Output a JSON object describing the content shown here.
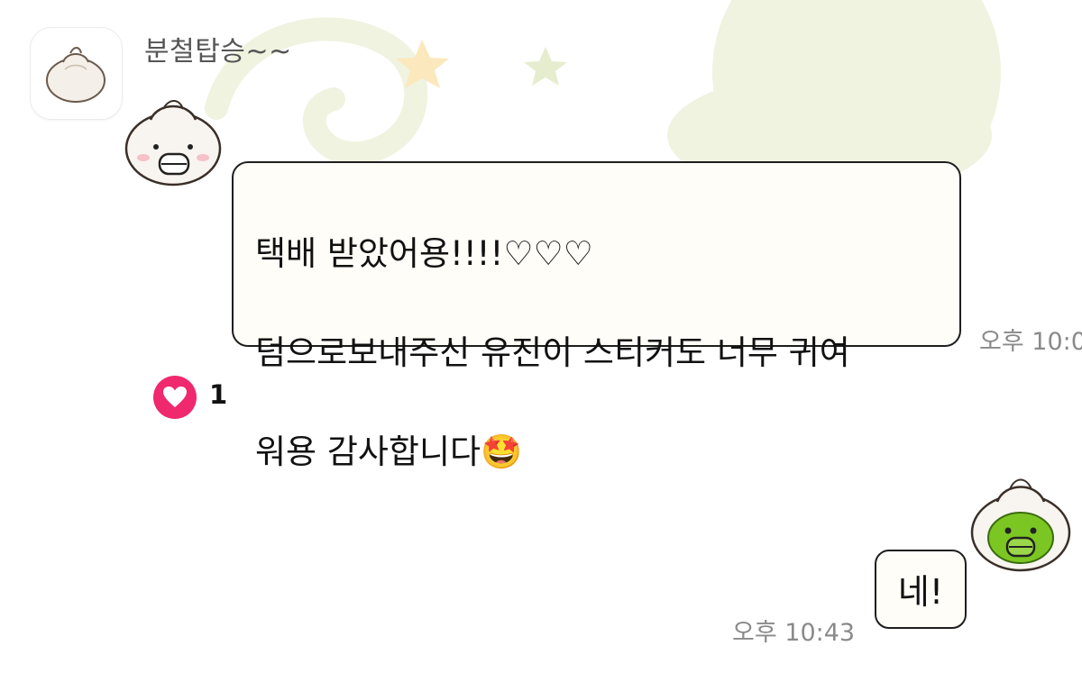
{
  "chat": {
    "sender_name": "분철탑승~~",
    "incoming": {
      "lines": [
        "택배 받았어용!!!!♡♡♡",
        "덤으로보내주신 유진이 스티커도 너무 귀여",
        "워용 감사합니다🤩"
      ],
      "time": "오후 10:0",
      "reaction": {
        "icon": "heart-icon",
        "count": "1"
      }
    },
    "outgoing": {
      "text": "네!",
      "time": "오후 10:43"
    }
  },
  "colors": {
    "reaction_heart": "#f0286e",
    "bubble_fill": "#fffdf7",
    "bubble_border": "#1e1e1e",
    "background_pattern": "#eef2dd"
  },
  "icons": {
    "avatar": "dumpling-avatar-icon",
    "incoming_sticker": "dumpling-face-sticker-icon",
    "outgoing_sticker": "green-dumpling-sticker-icon"
  }
}
